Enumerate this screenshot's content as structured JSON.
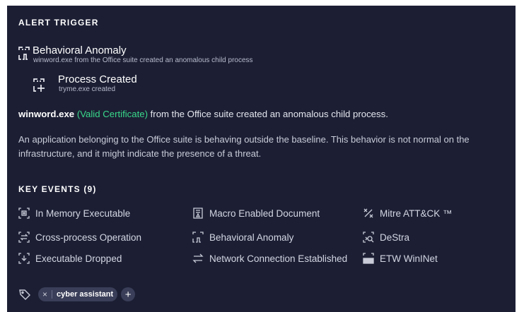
{
  "alert_trigger": {
    "heading": "ALERT TRIGGER",
    "items": [
      {
        "icon": "behavioral-anomaly-icon",
        "title": "Behavioral Anomaly",
        "subtitle": "winword.exe from the Office suite created an anomalous child process"
      },
      {
        "icon": "process-created-icon",
        "title": "Process Created",
        "subtitle": "tryme.exe created"
      }
    ]
  },
  "summary": {
    "process": "winword.exe",
    "certificate": "(Valid Certificate)",
    "text": " from the Office suite created an anomalous child process."
  },
  "description": "An application belonging to the Office suite is behaving outside the baseline. This behavior is not normal on the infrastructure, and it might indicate the presence of a threat.",
  "key_events": {
    "heading": "KEY EVENTS (9)",
    "events": [
      {
        "label": "In Memory Executable",
        "icon": "in-memory-executable-icon"
      },
      {
        "label": "Macro Enabled Document",
        "icon": "macro-document-icon"
      },
      {
        "label": "Mitre ATT&CK ™",
        "icon": "mitre-icon"
      },
      {
        "label": "Cross-process Operation",
        "icon": "cross-process-icon"
      },
      {
        "label": "Behavioral Anomaly",
        "icon": "behavioral-anomaly-icon"
      },
      {
        "label": "DeStra",
        "icon": "destra-icon"
      },
      {
        "label": "Executable Dropped",
        "icon": "executable-dropped-icon"
      },
      {
        "label": "Network Connection Established",
        "icon": "network-connection-icon"
      },
      {
        "label": "ETW WinINet",
        "icon": "etw-wininet-icon"
      }
    ]
  },
  "tags": {
    "icon": "tag-icon",
    "items": [
      {
        "label": "cyber assistant",
        "remove": "×"
      }
    ],
    "add": "+"
  },
  "colors": {
    "panel": "#1c1f34",
    "accent_green": "#39d98a",
    "chip": "#3a3e58"
  }
}
